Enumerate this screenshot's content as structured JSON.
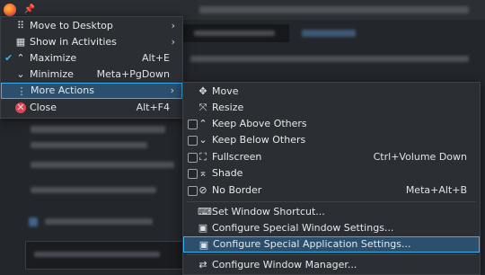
{
  "window_menu": {
    "items": [
      {
        "label": "Move to Desktop",
        "shortcut": "",
        "icon": "desktop-icon",
        "arrow": true
      },
      {
        "label": "Show in Activities",
        "shortcut": "",
        "icon": "activities-icon",
        "arrow": true
      },
      {
        "label": "Maximize",
        "shortcut": "Alt+E",
        "icon": "maximize-icon",
        "checked": true
      },
      {
        "label": "Minimize",
        "shortcut": "Meta+PgDown",
        "icon": "minimize-icon"
      },
      {
        "label": "More Actions",
        "shortcut": "",
        "icon": "more-actions-icon",
        "arrow": true,
        "highlighted": true
      },
      {
        "label": "Close",
        "shortcut": "Alt+F4",
        "icon": "close-icon"
      }
    ]
  },
  "more_actions_menu": {
    "items": [
      {
        "label": "Move",
        "shortcut": ""
      },
      {
        "label": "Resize",
        "shortcut": ""
      },
      {
        "label": "Keep Above Others",
        "shortcut": "",
        "checkbox": true
      },
      {
        "label": "Keep Below Others",
        "shortcut": "",
        "checkbox": true
      },
      {
        "label": "Fullscreen",
        "shortcut": "Ctrl+Volume Down",
        "checkbox": true
      },
      {
        "label": "Shade",
        "shortcut": "",
        "checkbox": true
      },
      {
        "label": "No Border",
        "shortcut": "Meta+Alt+B",
        "checkbox": true
      },
      {
        "label": "Set Window Shortcut...",
        "shortcut": ""
      },
      {
        "label": "Configure Special Window Settings...",
        "shortcut": ""
      },
      {
        "label": "Configure Special Application Settings...",
        "shortcut": "",
        "highlighted": true
      },
      {
        "label": "Configure Window Manager...",
        "shortcut": ""
      }
    ]
  },
  "colors": {
    "highlight_border": "#3daee9",
    "highlight_bg": "#2b4f6d",
    "menu_bg": "#2b2e33",
    "close_icon": "#da4453"
  }
}
